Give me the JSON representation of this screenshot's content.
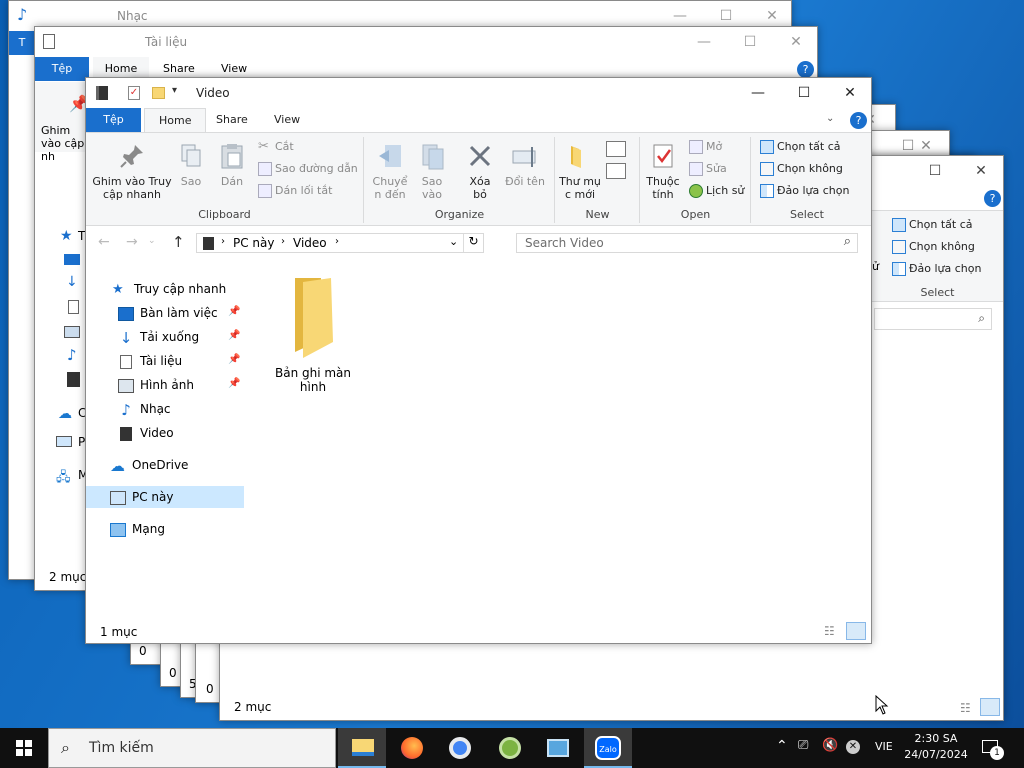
{
  "bgwin1": {
    "title": "Nhạc",
    "tab": "T"
  },
  "bgwin2": {
    "title": "Tài liệu",
    "tabs": [
      "Tệp",
      "Home",
      "Share",
      "View"
    ],
    "ribbon_partial": "Ghim vào cập nh",
    "status": "2 mục",
    "nav": [
      "T",
      "C",
      "P",
      "M"
    ]
  },
  "bgwin_right": {
    "buttons": [
      "Chọn tất cả",
      "Chọn không",
      "Đảo lựa chọn"
    ],
    "group": "Select",
    "status": "2 mục",
    "fragment": "ử"
  },
  "bgwin_stack": {
    "status_items": [
      "0",
      "0 i",
      "5 i",
      "0"
    ]
  },
  "main": {
    "title": "Video",
    "tabs": {
      "file": "Tệp",
      "home": "Home",
      "share": "Share",
      "view": "View"
    },
    "ribbon": {
      "clipboard": {
        "pin": "Ghim vào Truy cập nhanh",
        "copy": "Sao",
        "paste": "Dán",
        "cut": "Cắt",
        "copy_path": "Sao đường dẫn",
        "paste_shortcut": "Dán lối tắt",
        "label": "Clipboard"
      },
      "organize": {
        "move": "Chuyể n đến",
        "copyto": "Sao vào",
        "delete": "Xóa bỏ",
        "rename": "Đổi tên",
        "label": "Organize"
      },
      "new": {
        "new_folder": "Thư mụ c mới",
        "label": "New"
      },
      "open": {
        "properties": "Thuộc tính",
        "open": "Mở",
        "edit": "Sửa",
        "history": "Lịch sử",
        "label": "Open"
      },
      "select": {
        "all": "Chọn tất cả",
        "none": "Chọn không",
        "invert": "Đảo lựa chọn",
        "label": "Select"
      }
    },
    "address": {
      "crumbs": [
        "PC này",
        "Video"
      ]
    },
    "search_placeholder": "Search Video",
    "nav": {
      "quick": "Truy cập nhanh",
      "desktop": "Bàn làm việc",
      "downloads": "Tải xuống",
      "documents": "Tài liệu",
      "pictures": "Hình ảnh",
      "music": "Nhạc",
      "video": "Video",
      "onedrive": "OneDrive",
      "pc": "PC này",
      "network": "Mạng"
    },
    "folder": {
      "name": "Bản ghi màn hình"
    },
    "status": "1 mục"
  },
  "taskbar": {
    "search": "Tìm kiếm",
    "lang": "VIE",
    "time": "2:30 SA",
    "date": "24/07/2024",
    "notif": "1",
    "zalo": "Zalo"
  },
  "colors": {
    "accent": "#1a6fcd",
    "taskbar": "#101010",
    "selection": "#cce8ff",
    "folder": "#f8d775"
  }
}
